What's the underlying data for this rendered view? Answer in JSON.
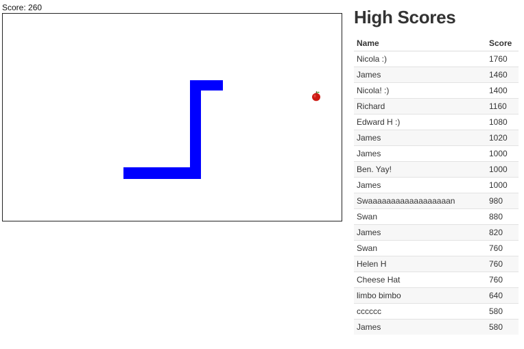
{
  "score_label": "Score: 260",
  "game": {
    "snake_color": "#0000ff",
    "food_icon": "apple-icon"
  },
  "high_scores": {
    "title": "High Scores",
    "columns": [
      "Name",
      "Score"
    ],
    "rows": [
      {
        "name": "Nicola :)",
        "score": "1760"
      },
      {
        "name": "James",
        "score": "1460"
      },
      {
        "name": "Nicola! :)",
        "score": "1400"
      },
      {
        "name": "Richard",
        "score": "1160"
      },
      {
        "name": "Edward H :)",
        "score": "1080"
      },
      {
        "name": "James",
        "score": "1020"
      },
      {
        "name": "James",
        "score": "1000"
      },
      {
        "name": "Ben. Yay!",
        "score": "1000"
      },
      {
        "name": "James",
        "score": "1000"
      },
      {
        "name": "Swaaaaaaaaaaaaaaaaaan",
        "score": "980"
      },
      {
        "name": "Swan",
        "score": "880"
      },
      {
        "name": "James",
        "score": "820"
      },
      {
        "name": "Swan",
        "score": "760"
      },
      {
        "name": "Helen H",
        "score": "760"
      },
      {
        "name": "Cheese Hat",
        "score": "760"
      },
      {
        "name": "limbo bimbo",
        "score": "640"
      },
      {
        "name": "cccccc",
        "score": "580"
      },
      {
        "name": "James",
        "score": "580"
      }
    ]
  }
}
